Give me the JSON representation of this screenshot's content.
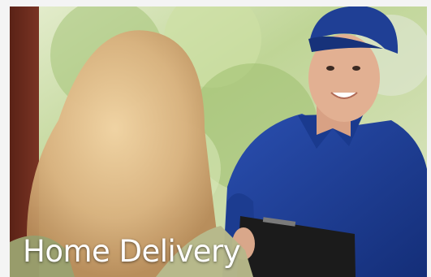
{
  "banner": {
    "caption": "Home Delivery",
    "image_subject": "delivery-man-in-blue-cap-and-polo-holding-clipboard-greeting-blonde-woman-at-door"
  },
  "colors": {
    "uniform_blue": "#1f3f95",
    "foliage_green": "#b9d08f",
    "door_brown": "#6b2a1c",
    "hair_blonde": "#d9b27f",
    "caption_text": "#ffffff"
  }
}
